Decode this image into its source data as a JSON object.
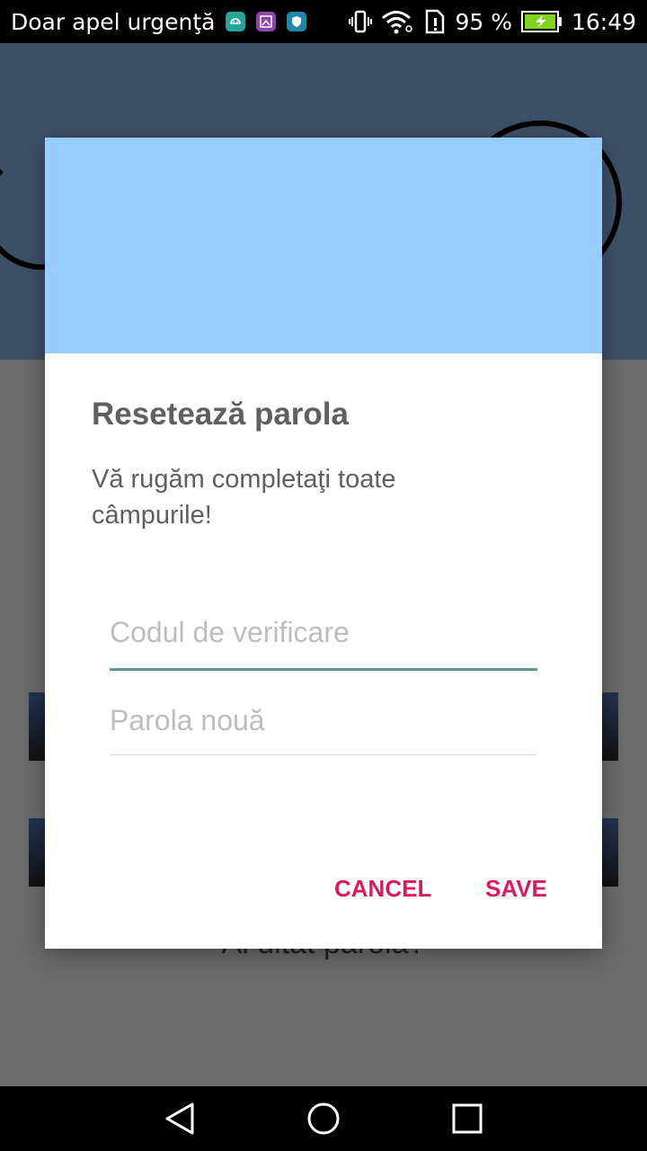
{
  "status_bar": {
    "carrier": "Doar apel urgenţă",
    "battery_percent": "95 %",
    "time": "16:49",
    "notification_icons": [
      "android-icon",
      "gallery-icon",
      "shield-icon"
    ]
  },
  "background_app": {
    "forgot_password_text": "Ai uitat parola?"
  },
  "dialog": {
    "title": "Resetează parola",
    "message": "Vă rugăm completaţi toate câmpurile!",
    "verification_code_placeholder": "Codul de verificare",
    "verification_code_value": "",
    "new_password_placeholder": "Parola nouă",
    "new_password_value": "",
    "cancel_label": "CANCEL",
    "save_label": "SAVE",
    "banner_color": "#99cdff",
    "accent_color": "#d81b60",
    "focused_underline_color": "#5b9a8f"
  },
  "navigation_bar": {
    "buttons": [
      "back-icon",
      "home-icon",
      "recents-icon"
    ]
  }
}
